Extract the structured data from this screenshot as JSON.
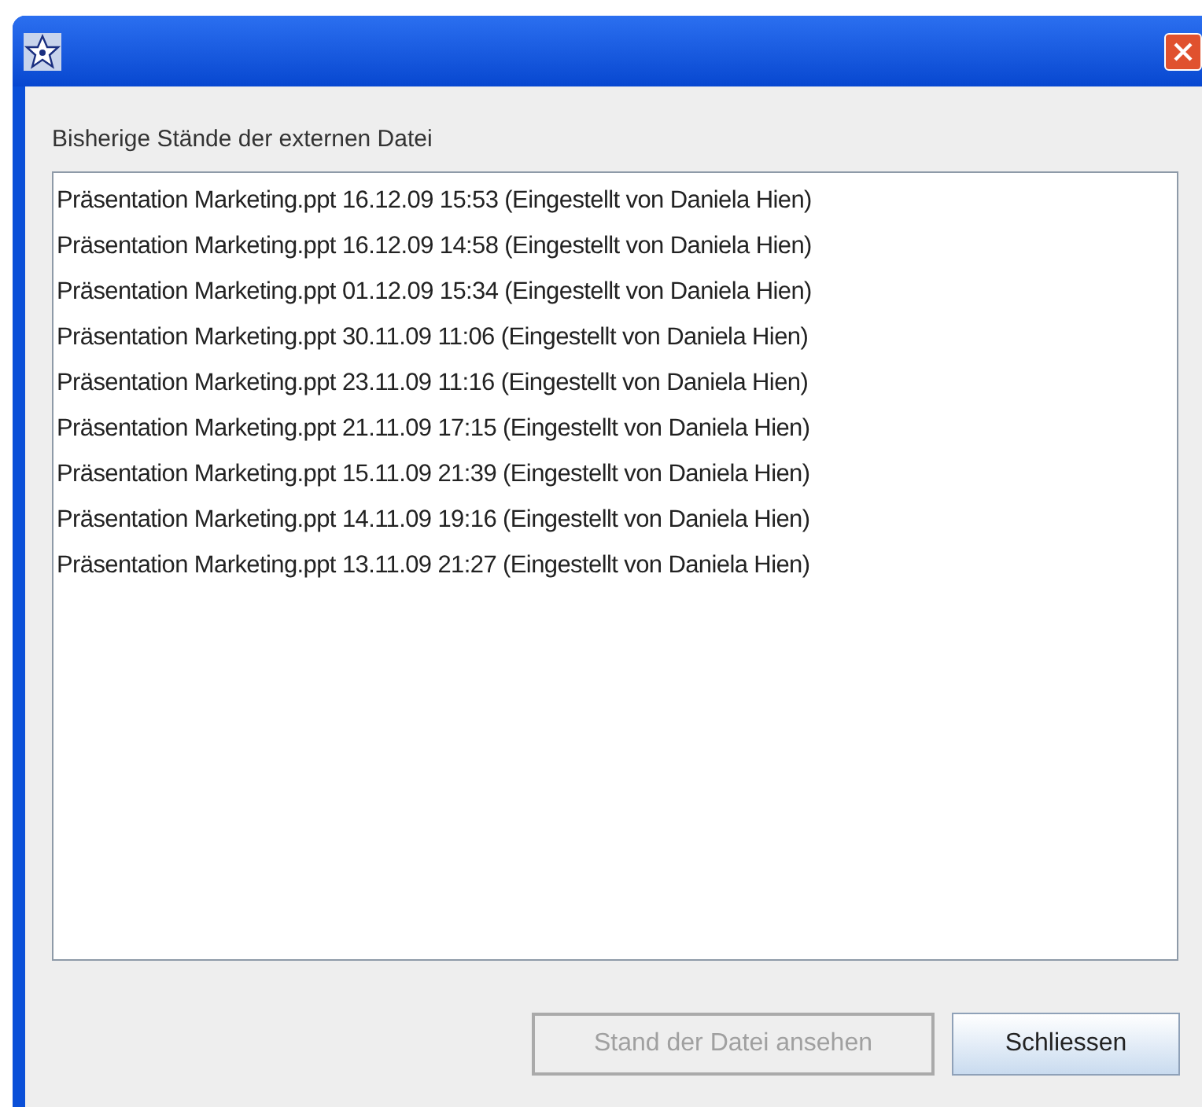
{
  "label": "Bisherige Stände der externen Datei",
  "versions": [
    {
      "text": "Präsentation Marketing.ppt 16.12.09 15:53 (Eingestellt von Daniela Hien)",
      "selected": false
    },
    {
      "text": "Präsentation Marketing.ppt 16.12.09 14:58 (Eingestellt von Daniela Hien)",
      "selected": false
    },
    {
      "text": "Präsentation Marketing.ppt 01.12.09 15:34 (Eingestellt von Daniela Hien)",
      "selected": false
    },
    {
      "text": "Präsentation Marketing.ppt 30.11.09 11:06 (Eingestellt von Daniela Hien)",
      "selected": false
    },
    {
      "text": "Präsentation Marketing.ppt 23.11.09 11:16 (Eingestellt von Daniela Hien)",
      "selected": false
    },
    {
      "text": "Präsentation Marketing.ppt 21.11.09 17:15 (Eingestellt von Daniela Hien)",
      "selected": false
    },
    {
      "text": "Präsentation Marketing.ppt 15.11.09 21:39 (Eingestellt von Daniela Hien)",
      "selected": false
    },
    {
      "text": "Präsentation Marketing.ppt 14.11.09 19:16 (Eingestellt von Daniela Hien)",
      "selected": false
    },
    {
      "text": "Präsentation Marketing.ppt 13.11.09 21:27 (Eingestellt von Daniela Hien)",
      "selected": false
    }
  ],
  "buttons": [
    {
      "label": "Stand der Datei ansehen",
      "disabled": true
    },
    {
      "label": "Schliessen",
      "disabled": false
    }
  ]
}
